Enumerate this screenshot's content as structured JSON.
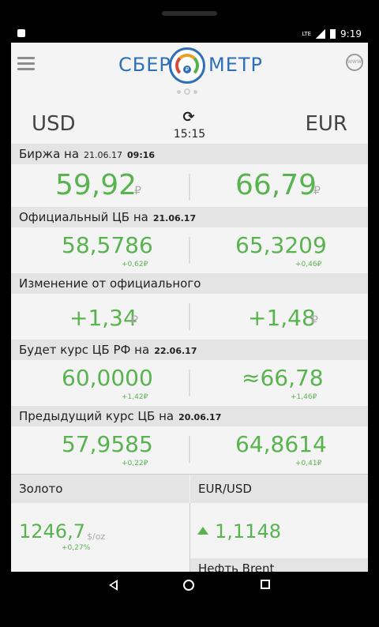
{
  "status": {
    "time": "9:19",
    "network": "LTE"
  },
  "header": {
    "logo_left": "СБЕР",
    "logo_right": "МЕТР",
    "gauge_symbol": "₽",
    "globe_label": "WWW"
  },
  "currencies": {
    "left": "USD",
    "right": "EUR",
    "refresh_icon": "⟳",
    "updated_time": "15:15"
  },
  "sections": {
    "exchange": {
      "label": "Биржа на",
      "date": "21.06.17",
      "time": "09:16",
      "usd": "59,92",
      "eur": "66,79"
    },
    "official": {
      "label": "Официальный ЦБ на",
      "date": "21.06.17",
      "usd": "58,5786",
      "usd_delta": "+0,62₽",
      "eur": "65,3209",
      "eur_delta": "+0,46₽"
    },
    "change": {
      "label": "Изменение от официального",
      "usd": "+1,34",
      "eur": "+1,48"
    },
    "next": {
      "label": "Будет курс ЦБ РФ на",
      "date": "22.06.17",
      "usd": "60,0000",
      "usd_delta": "+1,42₽",
      "eur": "≈66,78",
      "eur_delta": "+1,46₽"
    },
    "previous": {
      "label": "Предыдущий курс ЦБ на",
      "date": "20.06.17",
      "usd": "57,9585",
      "usd_delta": "+0,22₽",
      "eur": "64,8614",
      "eur_delta": "+0,41₽"
    }
  },
  "rub_symbol": "₽",
  "gold": {
    "label": "Золото",
    "value": "1246,7",
    "unit": "$/oz",
    "delta": "+0,27%"
  },
  "eurusd": {
    "label": "EUR/USD",
    "value": "1,1148"
  },
  "oil": {
    "label": "Нефть Brent"
  },
  "colors": {
    "accent_green": "#59b34f",
    "logo_blue": "#2f6fb6",
    "section_bg": "#e4e4e4"
  }
}
